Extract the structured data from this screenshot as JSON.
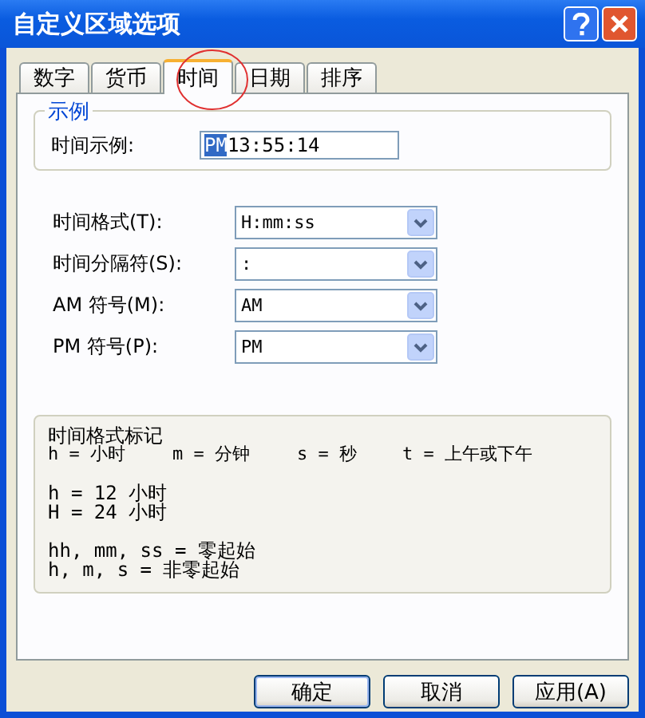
{
  "window": {
    "title": "自定义区域选项"
  },
  "tabs": [
    {
      "label": "数字",
      "selected": false
    },
    {
      "label": "货币",
      "selected": false
    },
    {
      "label": "时间",
      "selected": true
    },
    {
      "label": "日期",
      "selected": false
    },
    {
      "label": "排序",
      "selected": false
    }
  ],
  "sample": {
    "group_title": "示例",
    "label": "时间示例:",
    "value_selected": "PM",
    "value_rest": "13:55:14"
  },
  "fields": [
    {
      "label": "时间格式(T):",
      "value": "H:mm:ss"
    },
    {
      "label": "时间分隔符(S):",
      "value": ":"
    },
    {
      "label": "AM 符号(M):",
      "value": "AM"
    },
    {
      "label": "PM 符号(P):",
      "value": "PM"
    }
  ],
  "notes": {
    "title": "时间格式标记",
    "legend": [
      "h = 小时",
      "m = 分钟",
      "s = 秒",
      "t = 上午或下午"
    ],
    "groups": [
      [
        "h = 12 小时",
        "H = 24 小时"
      ],
      [
        "hh, mm, ss = 零起始",
        "h, m, s = 非零起始"
      ]
    ]
  },
  "buttons": [
    "确定",
    "取消",
    "应用(A)"
  ]
}
